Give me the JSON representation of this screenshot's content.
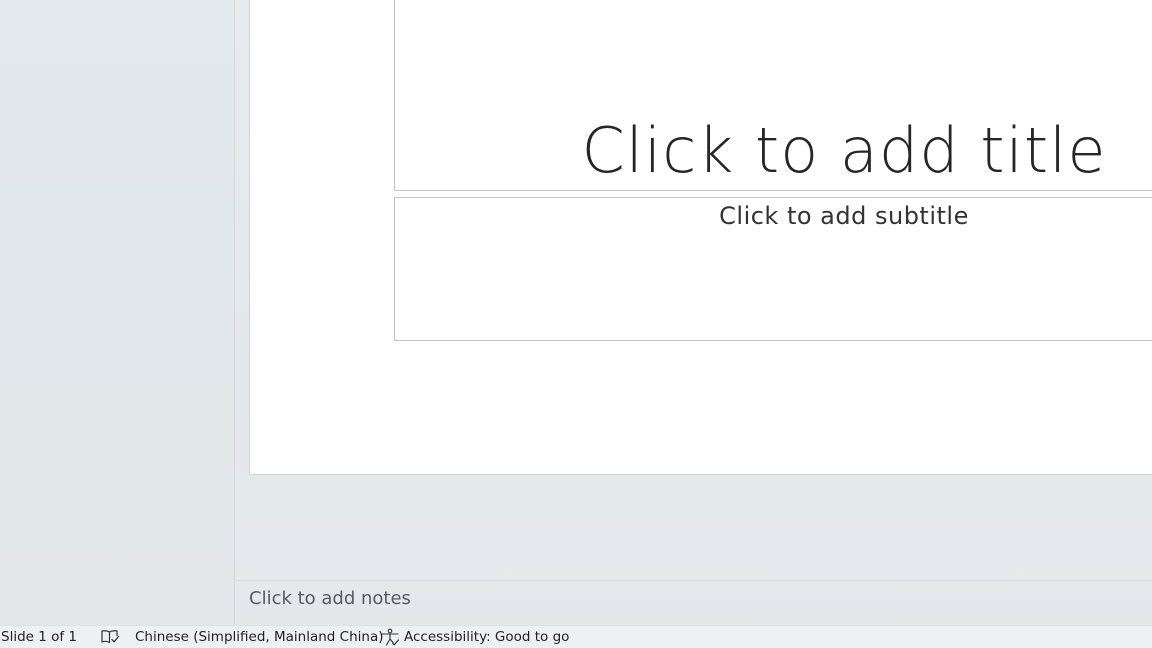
{
  "slide": {
    "title_placeholder": "Click to add title",
    "subtitle_placeholder": "Click to add subtitle"
  },
  "notes": {
    "placeholder": "Click to add notes"
  },
  "status_bar": {
    "slide_counter": "Slide 1 of 1",
    "proofing_icon": "book-check-icon",
    "language": "Chinese (Simplified, Mainland China)",
    "accessibility_icon": "accessibility-person-icon",
    "accessibility": "Accessibility: Good to go"
  }
}
